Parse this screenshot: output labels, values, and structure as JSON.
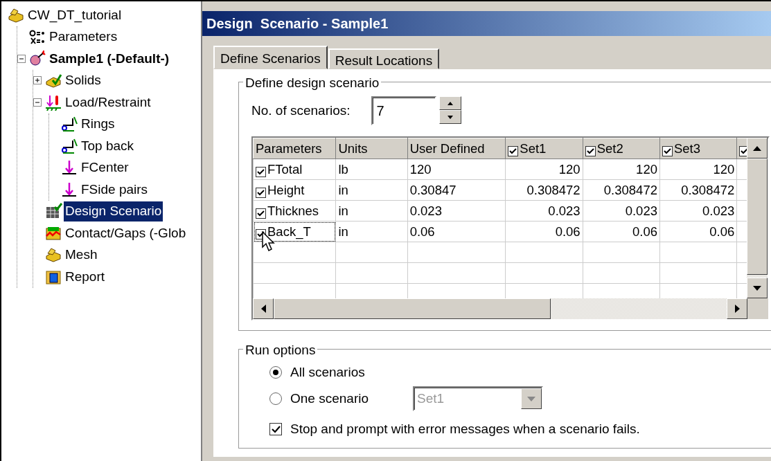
{
  "tree": {
    "items": [
      {
        "label": "CW_DT_tutorial",
        "kind": "part",
        "selected": false,
        "children": [
          {
            "label": "Parameters",
            "kind": "params",
            "selected": false
          },
          {
            "label": "Sample1 (-Default-)",
            "kind": "study",
            "bold": true,
            "expanded": true,
            "selected": false,
            "children": [
              {
                "label": "Solids",
                "kind": "solids",
                "expanded": false,
                "selected": false
              },
              {
                "label": "Load/Restraint",
                "kind": "load",
                "expanded": true,
                "selected": false,
                "children": [
                  {
                    "label": "Rings",
                    "kind": "restraint",
                    "selected": false
                  },
                  {
                    "label": "Top back",
                    "kind": "restraint",
                    "selected": false
                  },
                  {
                    "label": "FCenter",
                    "kind": "force",
                    "selected": false
                  },
                  {
                    "label": "FSide pairs",
                    "kind": "force",
                    "selected": false
                  }
                ]
              },
              {
                "label": "Design Scenario",
                "kind": "table",
                "selected": true
              },
              {
                "label": "Contact/Gaps (-Glob",
                "kind": "contact",
                "selected": false
              },
              {
                "label": "Mesh",
                "kind": "part",
                "selected": false
              },
              {
                "label": "Report",
                "kind": "report",
                "selected": false
              }
            ]
          }
        ]
      }
    ]
  },
  "dialog": {
    "title": "Design  Scenario - Sample1",
    "tabs": [
      {
        "label": "Define Scenarios",
        "selected": true
      },
      {
        "label": "Result Locations",
        "selected": false
      }
    ],
    "define_group": {
      "title": "Define design scenario",
      "scenarios_label": "No. of scenarios:",
      "scenarios_value": "7",
      "table": {
        "columns": [
          {
            "label": "Parameters"
          },
          {
            "label": "Units"
          },
          {
            "label": "User Defined"
          },
          {
            "label": "Set1",
            "checked": true
          },
          {
            "label": "Set2",
            "checked": true
          },
          {
            "label": "Set3",
            "checked": true
          },
          {
            "checked": true
          }
        ],
        "rows": [
          {
            "checked": true,
            "focused": false,
            "cells": [
              "FTotal",
              "lb",
              "120",
              "120",
              "120",
              "120"
            ]
          },
          {
            "checked": true,
            "focused": false,
            "cells": [
              "Height",
              "in",
              "0.30847",
              "0.308472",
              "0.308472",
              "0.308472"
            ]
          },
          {
            "checked": true,
            "focused": false,
            "cells": [
              "Thicknes",
              "in",
              "0.023",
              "0.023",
              "0.023",
              "0.023"
            ]
          },
          {
            "checked": true,
            "focused": true,
            "cells": [
              "Back_T",
              "in",
              "0.06",
              "0.06",
              "0.06",
              "0.06"
            ]
          }
        ]
      }
    },
    "run_group": {
      "title": "Run options",
      "radios": [
        {
          "label": "All scenarios",
          "selected": true
        },
        {
          "label": "One scenario",
          "selected": false
        }
      ],
      "set_select": {
        "value": "Set1",
        "disabled": true
      },
      "stop_checkbox": {
        "label": "Stop and prompt with error messages when a scenario fails.",
        "checked": true
      }
    }
  }
}
